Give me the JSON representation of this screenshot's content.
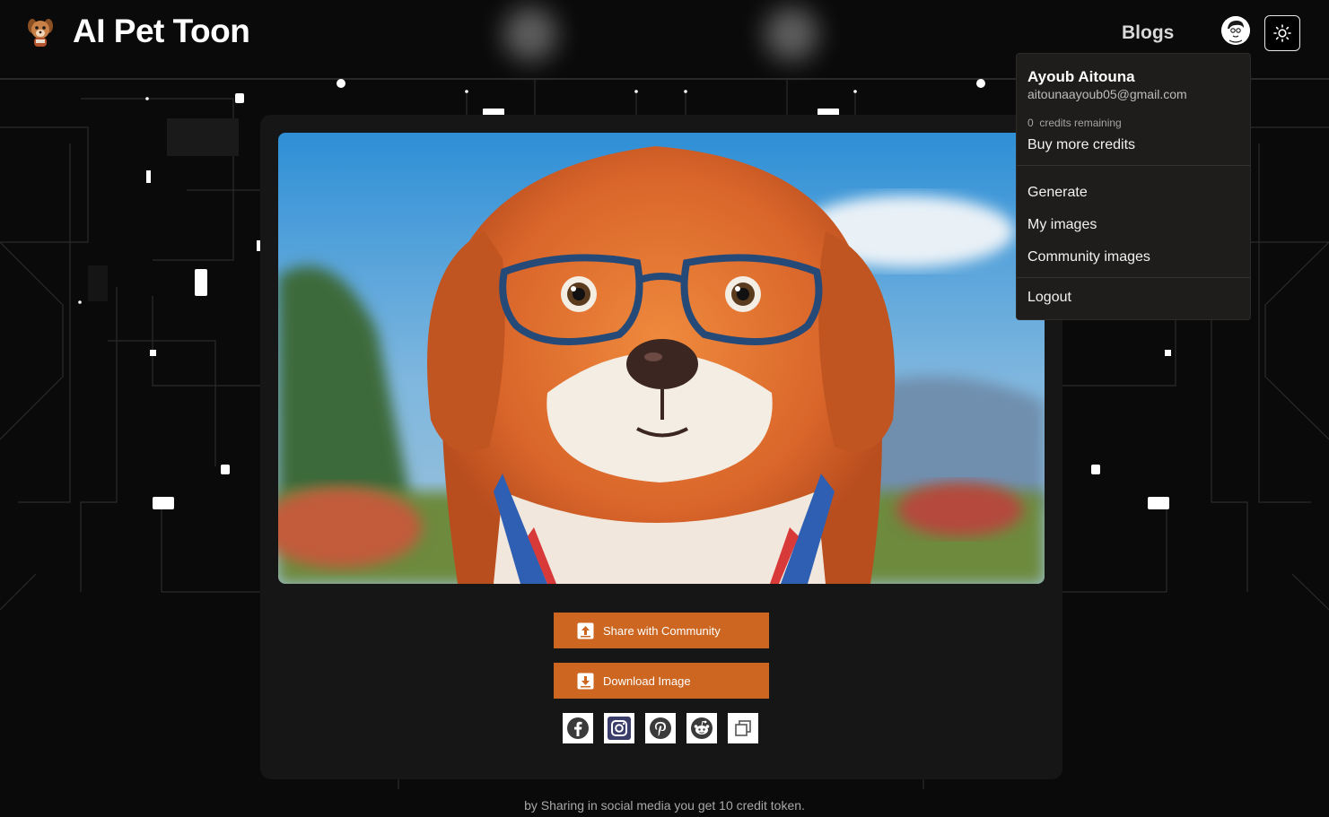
{
  "header": {
    "brand": "AI Pet Toon",
    "nav_blogs": "Blogs",
    "logo_icon": "puppy-logo-icon",
    "avatar_icon": "user-avatar-icon",
    "theme_icon": "sun-icon"
  },
  "main": {
    "image_alt": "cartoon orange dog wearing blue glasses",
    "share_label": "Share with Community",
    "download_label": "Download Image",
    "social": [
      "facebook-icon",
      "instagram-icon",
      "pinterest-icon",
      "reddit-icon",
      "copy-icon"
    ]
  },
  "footer": {
    "note": "by Sharing in social media you get 10 credit token."
  },
  "dropdown": {
    "name": "Ayoub Aitouna",
    "email": "aitounaayoub05@gmail.com",
    "credits_count": "0",
    "credits_label": "credits remaining",
    "buy_label": "Buy more credits",
    "menu": [
      "Generate",
      "My images",
      "Community images"
    ],
    "logout": "Logout"
  },
  "colors": {
    "accent": "#cc6620",
    "background": "#0a0a0a",
    "card": "#171616",
    "dropdown": "#1f1d1b"
  }
}
